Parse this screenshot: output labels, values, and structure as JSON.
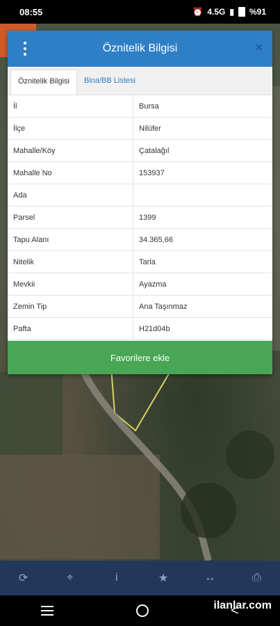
{
  "status": {
    "time": "08:55",
    "network": "4.5G",
    "battery": "%91"
  },
  "dialog": {
    "title": "Öznitelik Bilgisi",
    "close": "×",
    "tabs": [
      "Öznitelik Bilgisi",
      "Bina/BB Listesi"
    ],
    "rows": [
      {
        "label": "İl",
        "value": "Bursa"
      },
      {
        "label": "İlçe",
        "value": "Nilüfer"
      },
      {
        "label": "Mahalle/Köy",
        "value": "Çatalağıl"
      },
      {
        "label": "Mahalle No",
        "value": "153937"
      },
      {
        "label": "Ada",
        "value": ""
      },
      {
        "label": "Parsel",
        "value": "1399"
      },
      {
        "label": "Tapu Alanı",
        "value": "34.365,66"
      },
      {
        "label": "Nitelik",
        "value": "Tarla"
      },
      {
        "label": "Mevkii",
        "value": "Ayazma"
      },
      {
        "label": "Zemin Tip",
        "value": "Ana Taşınmaz"
      },
      {
        "label": "Pafta",
        "value": "H21d04b"
      }
    ],
    "favorite_button": "Favorilere ekle"
  },
  "toolbar": {
    "icons": [
      "refresh-icon",
      "crosshair-icon",
      "info-icon",
      "star-icon",
      "measure-icon",
      "print-icon"
    ],
    "glyphs": [
      "⟳",
      "⌖",
      "i",
      "★",
      "↔",
      "⎙"
    ]
  },
  "nav": {
    "back": "<"
  },
  "watermark": "ilanlar.com",
  "colors": {
    "header": "#2f7fc7",
    "favorite": "#48a655",
    "toolbar": "#22385a"
  }
}
